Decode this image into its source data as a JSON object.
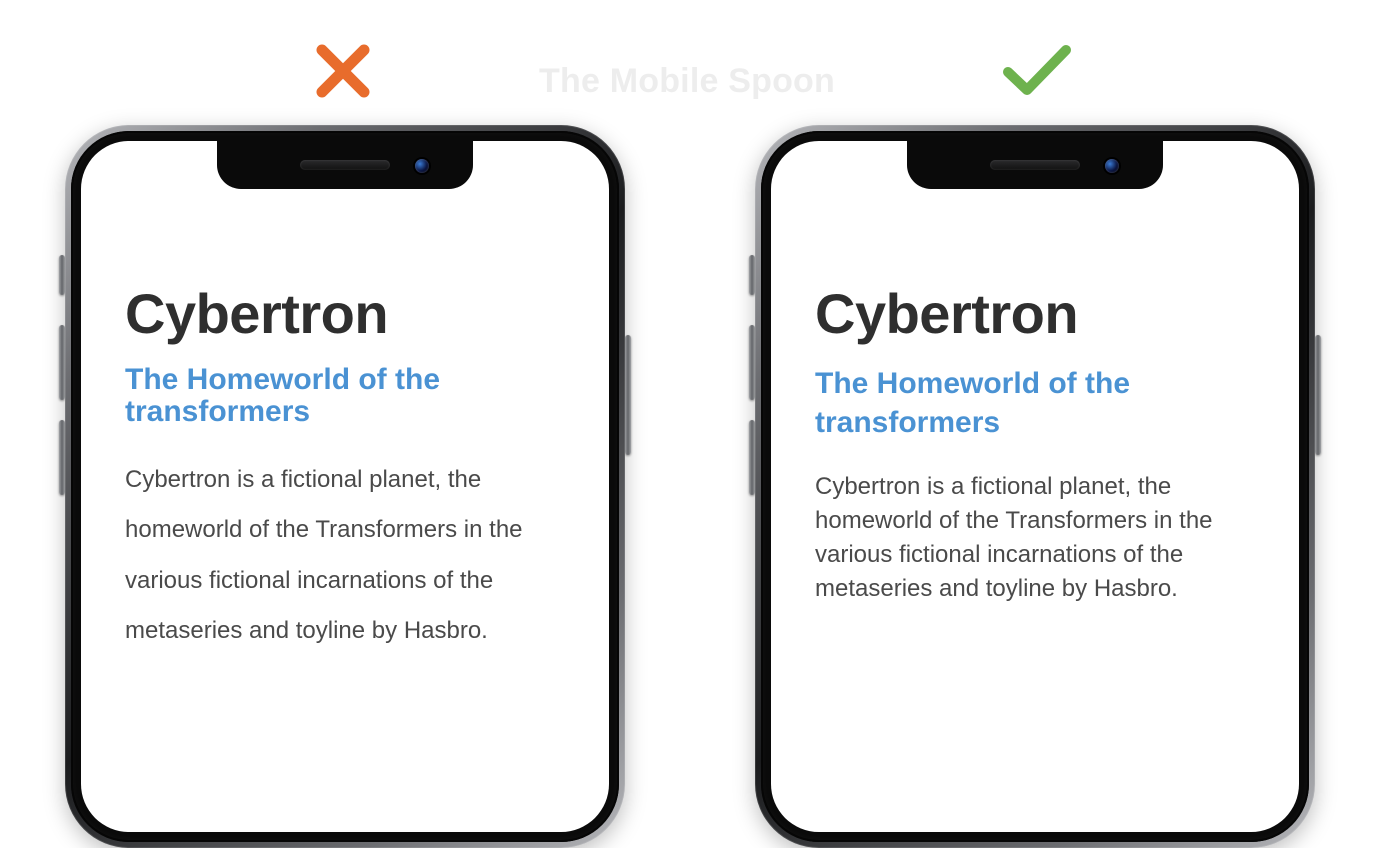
{
  "watermark": "The Mobile Spoon",
  "marks": {
    "wrong": "cross",
    "right": "check"
  },
  "left": {
    "title": "Cybertron",
    "subtitle": "The Homeworld of the transformers",
    "body": "Cybertron is a fictional planet, the homeworld of the Transformers in the various fictional incarnations of the metaseries and toyline by Hasbro."
  },
  "right": {
    "title": "Cybertron",
    "subtitle": "The Homeworld of the transformers",
    "body": "Cybertron is a fictional planet, the homeworld of the Transformers in the various fictional incarnations of the metaseries and toyline by Hasbro."
  },
  "colors": {
    "cross": "#e86c2c",
    "check": "#6eb24e",
    "subtitle": "#4a92d3"
  }
}
